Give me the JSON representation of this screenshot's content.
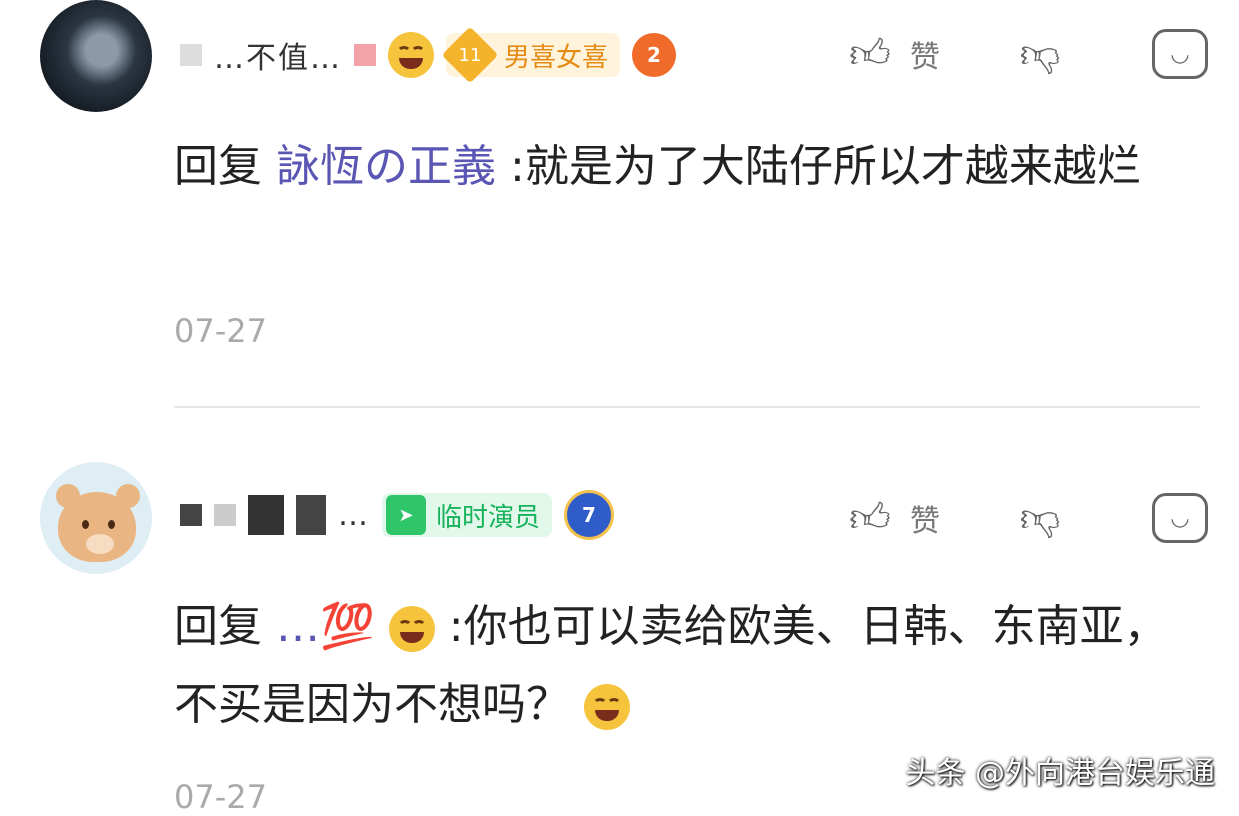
{
  "comments": [
    {
      "name": "…不值…",
      "badge_level": "11",
      "badge_title": "男喜女喜",
      "medal": "2",
      "like_label": "赞",
      "reply_prefix": "回复",
      "reply_to": "詠恆の正義",
      "text": ":就是为了大陆仔所以才越来越烂",
      "date": "07-27"
    },
    {
      "name": "…",
      "badge_level": "",
      "badge_title": "临时演员",
      "medal": "7",
      "like_label": "赞",
      "reply_prefix": "回复",
      "reply_to": "…💯",
      "text": ":你也可以卖给欧美、日韩、东南亚，不买是因为不想吗？",
      "date": "07-27"
    }
  ],
  "watermark": "头条 @外向港台娱乐通",
  "colors": {
    "accent_name": "#5a56b4",
    "badge_orange": "#e38b12",
    "badge_green": "#17b25c"
  },
  "icons": [
    "thumbs-up-icon",
    "thumbs-down-icon",
    "reply-bubble-icon",
    "smile-emoji-icon"
  ]
}
